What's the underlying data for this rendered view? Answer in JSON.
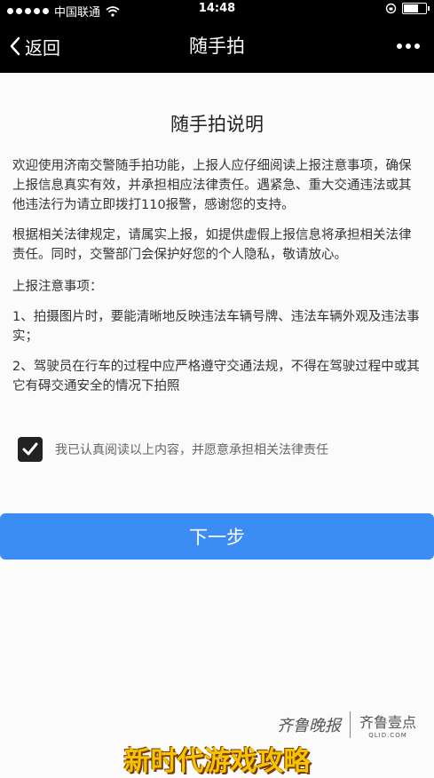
{
  "status_bar": {
    "carrier": "中国联通",
    "time": "14:48"
  },
  "nav": {
    "back_label": "返回",
    "title": "随手拍"
  },
  "doc": {
    "title": "随手拍说明",
    "paragraphs": [
      "欢迎使用济南交警随手拍功能，上报人应仔细阅读上报注意事项，确保上报信息真实有效，并承担相应法律责任。遇紧急、重大交通违法或其他违法行为请立即拨打110报警，感谢您的支持。",
      "根据相关法律规定，请属实上报，如提供虚假上报信息将承担相关法律责任。同时，交警部门会保护好您的个人隐私，敬请放心。",
      "上报注意事项：",
      "1、拍摄图片时，要能清晰地反映违法车辆号牌、违法车辆外观及违法事实；",
      "2、驾驶员在行车的过程中应严格遵守交通法规，不得在驾驶过程中或其它有碍交通安全的情况下拍照"
    ],
    "agree_text": "我已认真阅读以上内容，并愿意承担相关法律责任",
    "agree_checked": true,
    "next_label": "下一步"
  },
  "watermark": {
    "left": "齐鲁晚报",
    "right_cn": "齐鲁壹点",
    "right_en": "QLID.COM"
  },
  "overlay": "新时代游戏攻略",
  "colors": {
    "accent": "#3c8df3",
    "bar": "#000000",
    "overlay": "#f5c400"
  }
}
